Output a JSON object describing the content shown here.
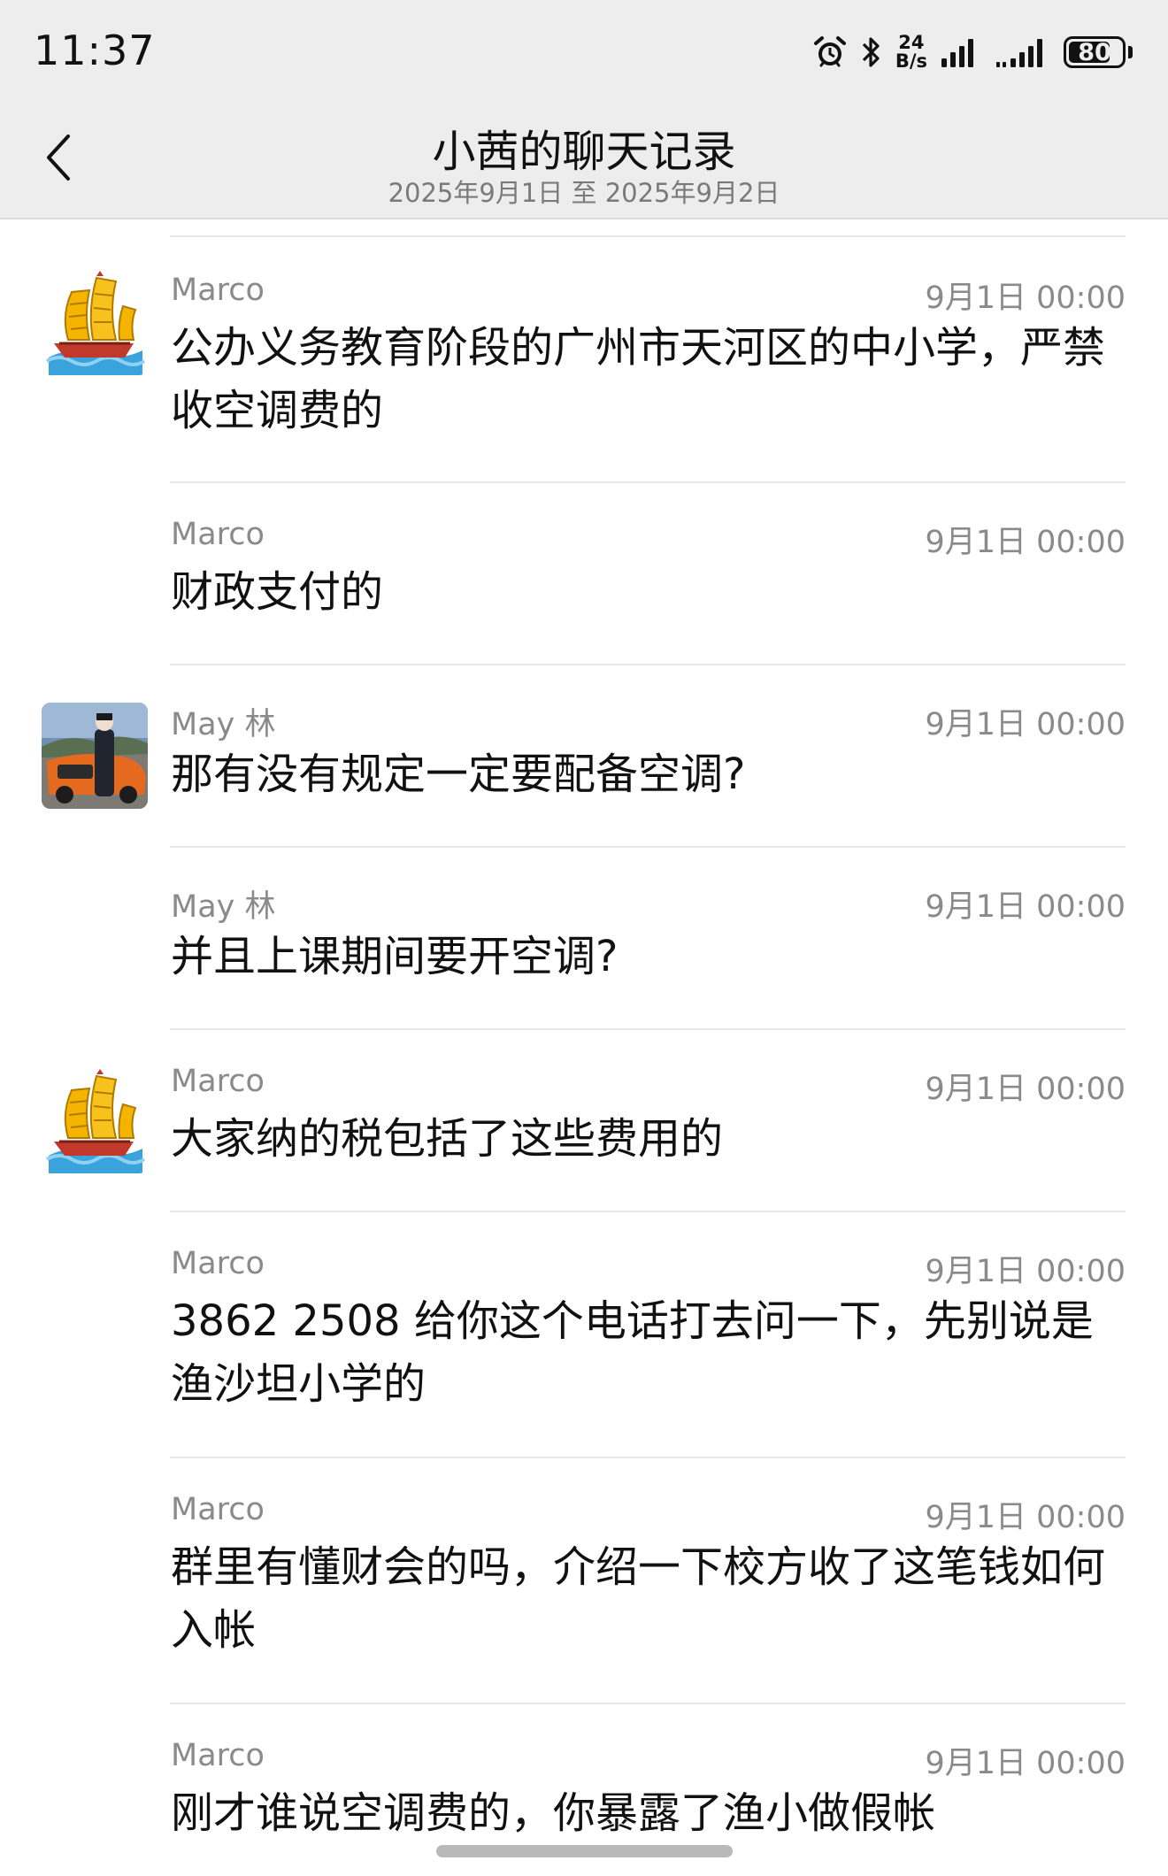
{
  "status_bar": {
    "time": "11:37",
    "net_speed_value": "24",
    "net_speed_unit": "B/s",
    "battery": "80",
    "battery_level": 0.8,
    "icons": [
      "alarm-icon",
      "bluetooth-icon",
      "signal-icon",
      "signal-icon"
    ]
  },
  "header": {
    "title": "小茜的聊天记录",
    "subtitle": "2025年9月1日 至 2025年9月2日",
    "back_icon": "chevron-left-icon"
  },
  "messages": [
    {
      "sender": "Marco",
      "time": "9月1日 00:00",
      "text": "公办义务教育阶段的广州市天河区的中小学，严禁收空调费的",
      "avatar": "junk-ship-avatar"
    },
    {
      "sender": "Marco",
      "time": "9月1日 00:00",
      "text": "财政支付的",
      "avatar": ""
    },
    {
      "sender": "May 林",
      "time": "9月1日 00:00",
      "text": "那有没有规定一定要配备空调?",
      "avatar": "photo-avatar"
    },
    {
      "sender": "May 林",
      "time": "9月1日 00:00",
      "text": "并且上课期间要开空调?",
      "avatar": ""
    },
    {
      "sender": "Marco",
      "time": "9月1日 00:00",
      "text": "大家纳的税包括了这些费用的",
      "avatar": "junk-ship-avatar"
    },
    {
      "sender": "Marco",
      "time": "9月1日 00:00",
      "text": "3862 2508 给你这个电话打去问一下，先别说是渔沙坦小学的",
      "avatar": ""
    },
    {
      "sender": "Marco",
      "time": "9月1日 00:00",
      "text": "群里有懂财会的吗，介绍一下校方收了这笔钱如何入帐",
      "avatar": ""
    },
    {
      "sender": "Marco",
      "time": "9月1日 00:00",
      "text": "刚才谁说空调费的，你暴露了渔小做假帐",
      "avatar": ""
    }
  ]
}
